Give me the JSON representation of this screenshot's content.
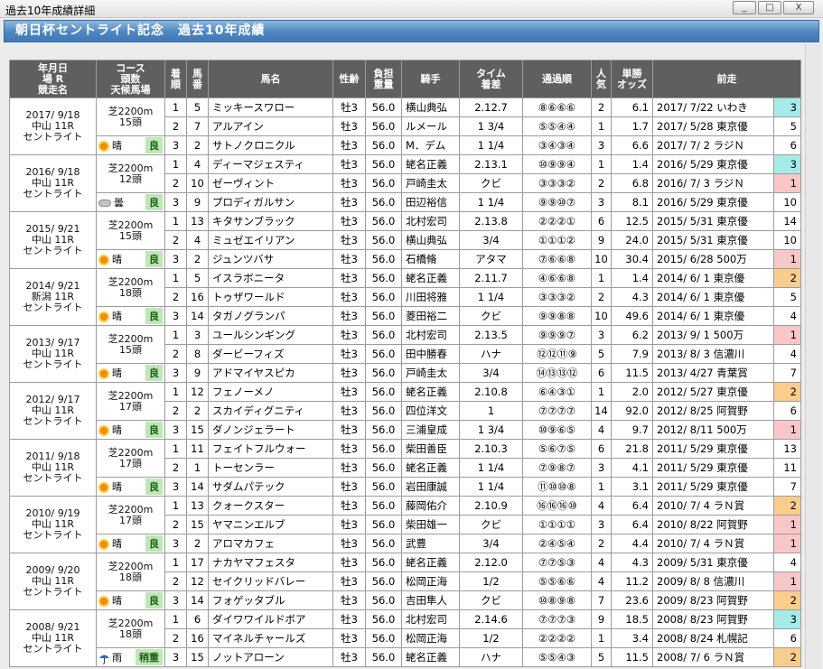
{
  "window": {
    "title": "過去10年成績詳細",
    "buttons": [
      "_",
      "□",
      "X"
    ]
  },
  "header": {
    "title": "朝日杯セントライト記念　過去10年成績"
  },
  "columns": [
    "年月日\n場 R\n競走名",
    "コース\n頭数\n天候馬場",
    "着\n順",
    "馬\n番",
    "馬名",
    "性齢",
    "負担\n重量",
    "騎手",
    "タイム\n着差",
    "通過順",
    "人\n気",
    "単勝\nオッズ",
    "前走"
  ],
  "colors": {
    "rank1": "#f9c7c7",
    "rank2": "#f9cd8c",
    "rank3": "#a6ebe7",
    "header_bg": "#5f5f5f",
    "title_bar": "#4d86c0",
    "baba_bg": "#bfe7b6"
  },
  "races": [
    {
      "date": "2017/ 9/18",
      "place": "中山 11R",
      "race": "セントライト",
      "course": "芝2200m",
      "heads": "15頭",
      "weather": "晴",
      "weather_icon": "sun-icon",
      "baba": "良",
      "rows": [
        {
          "rank": "1",
          "num": "5",
          "horse": "ミッキースワロー",
          "sexage": "牡3",
          "weight": "56.0",
          "jockey": "横山典弘",
          "time": "2.12.7",
          "pass": "⑧⑥⑥⑥",
          "pop": "2",
          "odds": "6.1",
          "prev": "2017/ 7/22 いわき",
          "prevres": "3"
        },
        {
          "rank": "2",
          "num": "7",
          "horse": "アルアイン",
          "sexage": "牡3",
          "weight": "56.0",
          "jockey": "ルメール",
          "time": "1 3/4",
          "pass": "⑤⑤④④",
          "pop": "1",
          "odds": "1.7",
          "prev": "2017/ 5/28 東京優",
          "prevres": "5"
        },
        {
          "rank": "3",
          "num": "2",
          "horse": "サトノクロニクル",
          "sexage": "牡3",
          "weight": "56.0",
          "jockey": "M．デム",
          "time": "1 1/4",
          "pass": "③④③④",
          "pop": "3",
          "odds": "6.6",
          "prev": "2017/ 7/ 2 ラジＮ",
          "prevres": "6"
        }
      ]
    },
    {
      "date": "2016/ 9/18",
      "place": "中山 11R",
      "race": "セントライト",
      "course": "芝2200m",
      "heads": "12頭",
      "weather": "曇",
      "weather_icon": "cloud-icon",
      "baba": "良",
      "rows": [
        {
          "rank": "1",
          "num": "4",
          "horse": "ディーマジェスティ",
          "sexage": "牡3",
          "weight": "56.0",
          "jockey": "蛯名正義",
          "time": "2.13.1",
          "pass": "⑩⑨⑨④",
          "pop": "1",
          "odds": "1.4",
          "prev": "2016/ 5/29 東京優",
          "prevres": "3"
        },
        {
          "rank": "2",
          "num": "10",
          "horse": "ゼーヴィント",
          "sexage": "牡3",
          "weight": "56.0",
          "jockey": "戸崎圭太",
          "time": "クビ",
          "pass": "③③③②",
          "pop": "2",
          "odds": "6.8",
          "prev": "2016/ 7/ 3 ラジＮ",
          "prevres": "1"
        },
        {
          "rank": "3",
          "num": "9",
          "horse": "プロディガルサン",
          "sexage": "牡3",
          "weight": "56.0",
          "jockey": "田辺裕信",
          "time": "1 1/4",
          "pass": "⑨⑨⑩⑦",
          "pop": "3",
          "odds": "8.1",
          "prev": "2016/ 5/29 東京優",
          "prevres": "10"
        }
      ]
    },
    {
      "date": "2015/ 9/21",
      "place": "中山 11R",
      "race": "セントライト",
      "course": "芝2200m",
      "heads": "15頭",
      "weather": "晴",
      "weather_icon": "sun-icon",
      "baba": "良",
      "rows": [
        {
          "rank": "1",
          "num": "13",
          "horse": "キタサンブラック",
          "sexage": "牡3",
          "weight": "56.0",
          "jockey": "北村宏司",
          "time": "2.13.8",
          "pass": "②②②①",
          "pop": "6",
          "odds": "12.5",
          "prev": "2015/ 5/31 東京優",
          "prevres": "14"
        },
        {
          "rank": "2",
          "num": "4",
          "horse": "ミュゼエイリアン",
          "sexage": "牡3",
          "weight": "56.0",
          "jockey": "横山典弘",
          "time": "3/4",
          "pass": "①①①②",
          "pop": "9",
          "odds": "24.0",
          "prev": "2015/ 5/31 東京優",
          "prevres": "10"
        },
        {
          "rank": "3",
          "num": "2",
          "horse": "ジュンツバサ",
          "sexage": "牡3",
          "weight": "56.0",
          "jockey": "石橋脩",
          "time": "アタマ",
          "pass": "⑦⑥⑥⑧",
          "pop": "10",
          "odds": "30.4",
          "prev": "2015/ 6/28 500万",
          "prevres": "1"
        }
      ]
    },
    {
      "date": "2014/ 9/21",
      "place": "新潟 11R",
      "race": "セントライト",
      "course": "芝2200m",
      "heads": "18頭",
      "weather": "晴",
      "weather_icon": "sun-icon",
      "baba": "良",
      "rows": [
        {
          "rank": "1",
          "num": "5",
          "horse": "イスラボニータ",
          "sexage": "牡3",
          "weight": "56.0",
          "jockey": "蛯名正義",
          "time": "2.11.7",
          "pass": "④⑥⑥⑧",
          "pop": "1",
          "odds": "1.4",
          "prev": "2014/ 6/ 1 東京優",
          "prevres": "2"
        },
        {
          "rank": "2",
          "num": "16",
          "horse": "トゥザワールド",
          "sexage": "牡3",
          "weight": "56.0",
          "jockey": "川田将雅",
          "time": "1 1/4",
          "pass": "③③③②",
          "pop": "2",
          "odds": "4.3",
          "prev": "2014/ 6/ 1 東京優",
          "prevres": "5"
        },
        {
          "rank": "3",
          "num": "14",
          "horse": "タガノグランパ",
          "sexage": "牡3",
          "weight": "56.0",
          "jockey": "菱田裕二",
          "time": "クビ",
          "pass": "⑨⑨⑧⑧",
          "pop": "10",
          "odds": "49.6",
          "prev": "2014/ 6/ 1 東京優",
          "prevres": "4"
        }
      ]
    },
    {
      "date": "2013/ 9/17",
      "place": "中山 11R",
      "race": "セントライト",
      "course": "芝2200m",
      "heads": "15頭",
      "weather": "晴",
      "weather_icon": "sun-icon",
      "baba": "良",
      "rows": [
        {
          "rank": "1",
          "num": "3",
          "horse": "ユールシンギング",
          "sexage": "牡3",
          "weight": "56.0",
          "jockey": "北村宏司",
          "time": "2.13.5",
          "pass": "⑨⑨⑨⑦",
          "pop": "3",
          "odds": "6.2",
          "prev": "2013/ 9/ 1 500万",
          "prevres": "1"
        },
        {
          "rank": "2",
          "num": "8",
          "horse": "ダービーフィズ",
          "sexage": "牡3",
          "weight": "56.0",
          "jockey": "田中勝春",
          "time": "ハナ",
          "pass": "⑫⑫⑪⑨",
          "pop": "5",
          "odds": "7.9",
          "prev": "2013/ 8/ 3 信濃川",
          "prevres": "4"
        },
        {
          "rank": "3",
          "num": "9",
          "horse": "アドマイヤスピカ",
          "sexage": "牡3",
          "weight": "56.0",
          "jockey": "戸崎圭太",
          "time": "3/4",
          "pass": "⑭⑬⑬⑫",
          "pop": "6",
          "odds": "11.5",
          "prev": "2013/ 4/27 青葉賞",
          "prevres": "7"
        }
      ]
    },
    {
      "date": "2012/ 9/17",
      "place": "中山 11R",
      "race": "セントライト",
      "course": "芝2200m",
      "heads": "17頭",
      "weather": "晴",
      "weather_icon": "sun-icon",
      "baba": "良",
      "rows": [
        {
          "rank": "1",
          "num": "12",
          "horse": "フェノーメノ",
          "sexage": "牡3",
          "weight": "56.0",
          "jockey": "蛯名正義",
          "time": "2.10.8",
          "pass": "⑥④③①",
          "pop": "1",
          "odds": "2.0",
          "prev": "2012/ 5/27 東京優",
          "prevres": "2"
        },
        {
          "rank": "2",
          "num": "2",
          "horse": "スカイディグニティ",
          "sexage": "牡3",
          "weight": "56.0",
          "jockey": "四位洋文",
          "time": "1",
          "pass": "⑦⑦⑦⑦",
          "pop": "14",
          "odds": "92.0",
          "prev": "2012/ 8/25 阿賀野",
          "prevres": "6"
        },
        {
          "rank": "3",
          "num": "15",
          "horse": "ダノンジェラート",
          "sexage": "牡3",
          "weight": "56.0",
          "jockey": "三浦皇成",
          "time": "1 3/4",
          "pass": "⑩⑨⑥⑤",
          "pop": "4",
          "odds": "9.7",
          "prev": "2012/ 8/11 500万",
          "prevres": "1"
        }
      ]
    },
    {
      "date": "2011/ 9/18",
      "place": "中山 11R",
      "race": "セントライト",
      "course": "芝2200m",
      "heads": "17頭",
      "weather": "晴",
      "weather_icon": "sun-icon",
      "baba": "良",
      "rows": [
        {
          "rank": "1",
          "num": "11",
          "horse": "フェイトフルウォー",
          "sexage": "牡3",
          "weight": "56.0",
          "jockey": "柴田善臣",
          "time": "2.10.3",
          "pass": "⑤⑥⑦⑤",
          "pop": "6",
          "odds": "21.8",
          "prev": "2011/ 5/29 東京優",
          "prevres": "13"
        },
        {
          "rank": "2",
          "num": "1",
          "horse": "トーセンラー",
          "sexage": "牡3",
          "weight": "56.0",
          "jockey": "蛯名正義",
          "time": "1 1/4",
          "pass": "⑦⑨⑧⑦",
          "pop": "3",
          "odds": "4.1",
          "prev": "2011/ 5/29 東京優",
          "prevres": "11"
        },
        {
          "rank": "3",
          "num": "14",
          "horse": "サダムパテック",
          "sexage": "牡3",
          "weight": "56.0",
          "jockey": "岩田康誠",
          "time": "1 1/4",
          "pass": "⑪⑩⑩⑧",
          "pop": "1",
          "odds": "3.1",
          "prev": "2011/ 5/29 東京優",
          "prevres": "7"
        }
      ]
    },
    {
      "date": "2010/ 9/19",
      "place": "中山 11R",
      "race": "セントライト",
      "course": "芝2200m",
      "heads": "17頭",
      "weather": "晴",
      "weather_icon": "sun-icon",
      "baba": "良",
      "rows": [
        {
          "rank": "1",
          "num": "13",
          "horse": "クォークスター",
          "sexage": "牡3",
          "weight": "56.0",
          "jockey": "藤岡佑介",
          "time": "2.10.9",
          "pass": "⑯⑯⑯⑩",
          "pop": "4",
          "odds": "6.4",
          "prev": "2010/ 7/ 4 ラＮ賞",
          "prevres": "2"
        },
        {
          "rank": "2",
          "num": "15",
          "horse": "ヤマニンエルブ",
          "sexage": "牡3",
          "weight": "56.0",
          "jockey": "柴田雄一",
          "time": "クビ",
          "pass": "①①①①",
          "pop": "3",
          "odds": "6.4",
          "prev": "2010/ 8/22 阿賀野",
          "prevres": "1"
        },
        {
          "rank": "3",
          "num": "2",
          "horse": "アロマカフェ",
          "sexage": "牡3",
          "weight": "56.0",
          "jockey": "武豊",
          "time": "3/4",
          "pass": "②④⑤④",
          "pop": "2",
          "odds": "4.4",
          "prev": "2010/ 7/ 4 ラＮ賞",
          "prevres": "1"
        }
      ]
    },
    {
      "date": "2009/ 9/20",
      "place": "中山 11R",
      "race": "セントライト",
      "course": "芝2200m",
      "heads": "18頭",
      "weather": "晴",
      "weather_icon": "sun-icon",
      "baba": "良",
      "rows": [
        {
          "rank": "1",
          "num": "17",
          "horse": "ナカヤマフェスタ",
          "sexage": "牡3",
          "weight": "56.0",
          "jockey": "蛯名正義",
          "time": "2.12.0",
          "pass": "⑦⑦⑤③",
          "pop": "4",
          "odds": "4.3",
          "prev": "2009/ 5/31 東京優",
          "prevres": "4"
        },
        {
          "rank": "2",
          "num": "12",
          "horse": "セイクリッドバレー",
          "sexage": "牡3",
          "weight": "56.0",
          "jockey": "松岡正海",
          "time": "1/2",
          "pass": "⑤⑤⑥⑥",
          "pop": "4",
          "odds": "11.2",
          "prev": "2009/ 8/ 8 信濃川",
          "prevres": "1"
        },
        {
          "rank": "3",
          "num": "14",
          "horse": "フォゲッタブル",
          "sexage": "牡3",
          "weight": "56.0",
          "jockey": "吉田隼人",
          "time": "クビ",
          "pass": "⑩⑧⑨⑧",
          "pop": "7",
          "odds": "23.6",
          "prev": "2009/ 8/23 阿賀野",
          "prevres": "2"
        }
      ]
    },
    {
      "date": "2008/ 9/21",
      "place": "中山 11R",
      "race": "セントライト",
      "course": "芝2200m",
      "heads": "18頭",
      "weather": "雨",
      "weather_icon": "umbrella-icon",
      "baba": "稍重",
      "rows": [
        {
          "rank": "1",
          "num": "6",
          "horse": "ダイワワイルドボア",
          "sexage": "牡3",
          "weight": "56.0",
          "jockey": "北村宏司",
          "time": "2.14.6",
          "pass": "⑦⑦⑦③",
          "pop": "9",
          "odds": "18.5",
          "prev": "2008/ 8/23 阿賀野",
          "prevres": "3"
        },
        {
          "rank": "2",
          "num": "16",
          "horse": "マイネルチャールズ",
          "sexage": "牡3",
          "weight": "56.0",
          "jockey": "松岡正海",
          "time": "1/2",
          "pass": "②②②②",
          "pop": "1",
          "odds": "3.4",
          "prev": "2008/ 8/24 札幌記",
          "prevres": "6"
        },
        {
          "rank": "3",
          "num": "15",
          "horse": "ノットアローン",
          "sexage": "牡3",
          "weight": "56.0",
          "jockey": "蛯名正義",
          "time": "ハナ",
          "pass": "⑤⑤④③",
          "pop": "5",
          "odds": "11.5",
          "prev": "2008/ 7/ 6 ラＮ賞",
          "prevres": "2"
        }
      ]
    }
  ]
}
